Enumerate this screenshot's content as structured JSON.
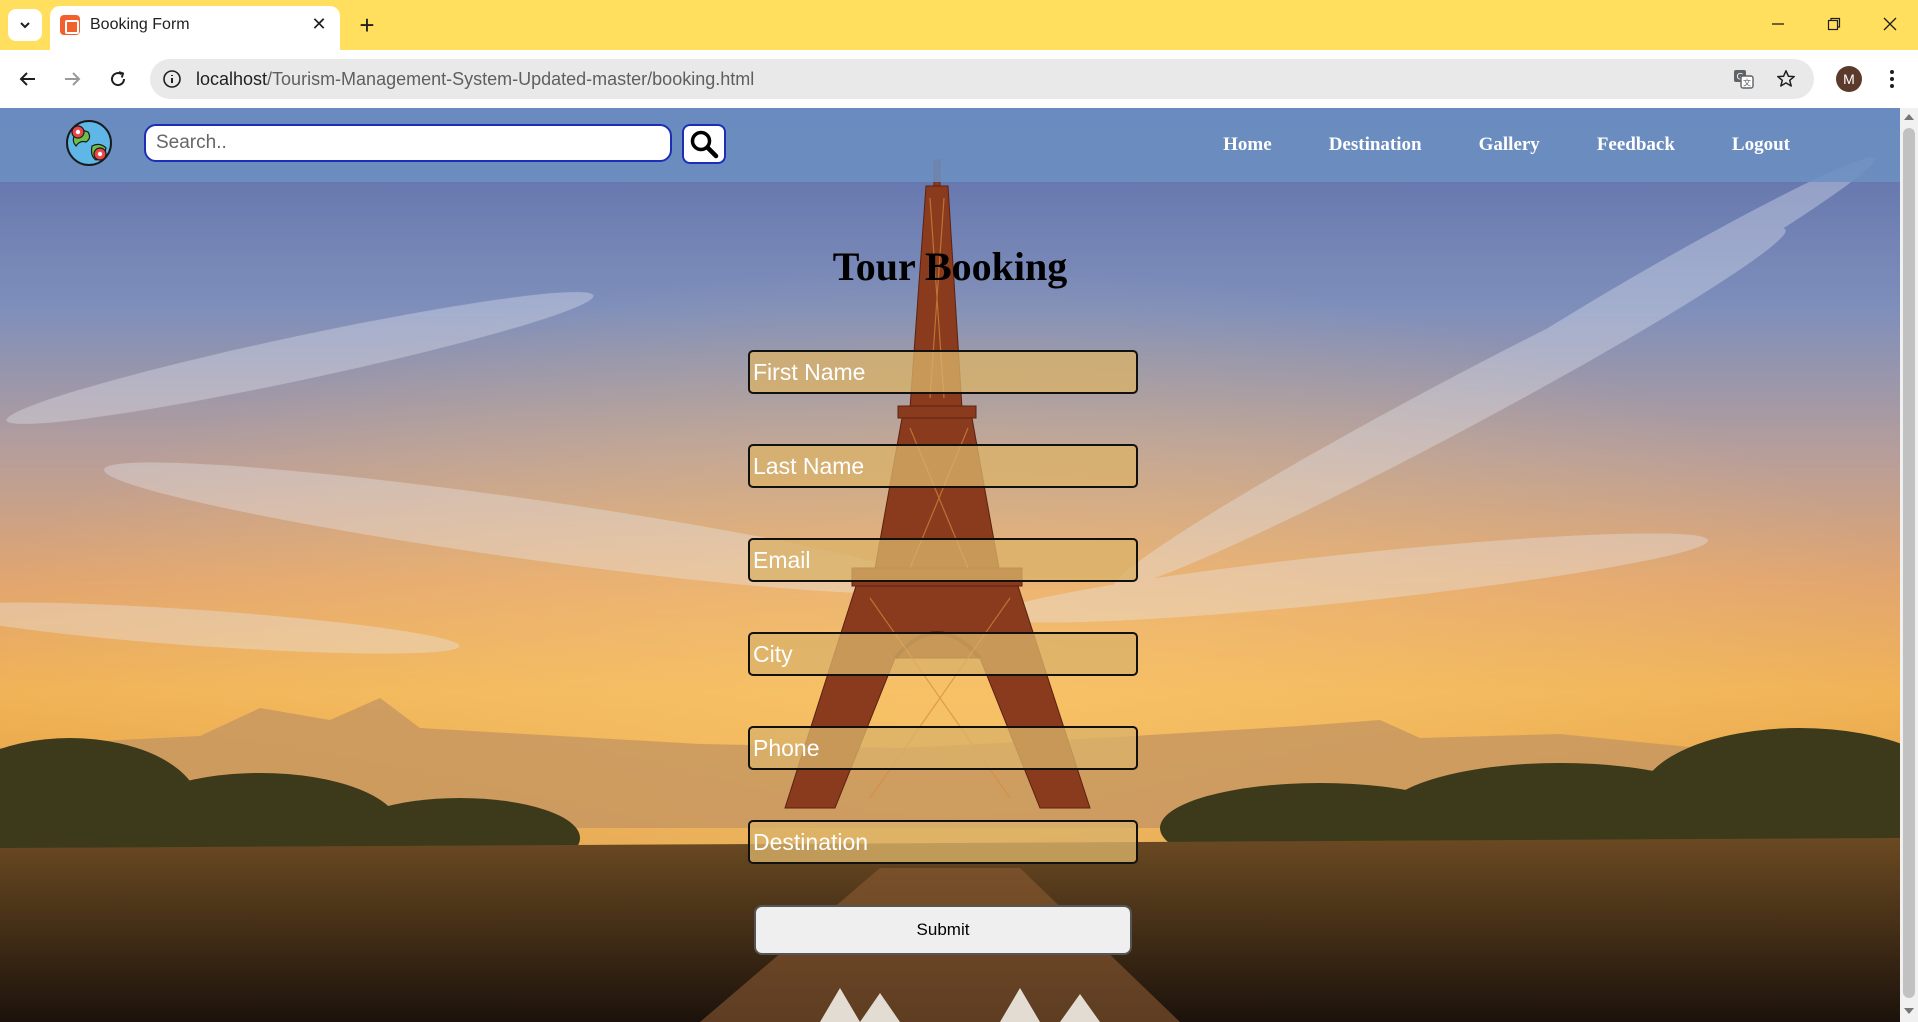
{
  "browser": {
    "tab_title": "Booking Form",
    "url_host": "localhost",
    "url_path": "/Tourism-Management-System-Updated-master/booking.html",
    "profile_initial": "M"
  },
  "header": {
    "search_placeholder": "Search..",
    "nav": [
      "Home",
      "Destination",
      "Gallery",
      "Feedback",
      "Logout"
    ]
  },
  "form": {
    "title": "Tour Booking",
    "fields": {
      "first_name": "First Name",
      "last_name": "Last Name",
      "email": "Email",
      "city": "City",
      "phone": "Phone",
      "destination": "Destination"
    },
    "submit_label": "Submit"
  },
  "colors": {
    "tabbar": "#ffdf5d",
    "navbar": "#6c8fc2",
    "field_fill": "#dab269",
    "search_border": "#1c2fb4"
  }
}
